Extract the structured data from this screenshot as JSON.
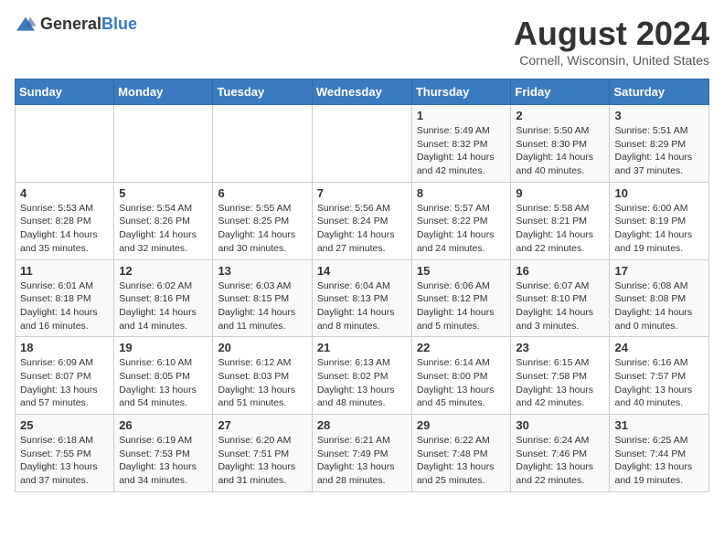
{
  "header": {
    "logo_general": "General",
    "logo_blue": "Blue",
    "month_year": "August 2024",
    "location": "Cornell, Wisconsin, United States"
  },
  "days_of_week": [
    "Sunday",
    "Monday",
    "Tuesday",
    "Wednesday",
    "Thursday",
    "Friday",
    "Saturday"
  ],
  "weeks": [
    [
      {
        "day": "",
        "content": ""
      },
      {
        "day": "",
        "content": ""
      },
      {
        "day": "",
        "content": ""
      },
      {
        "day": "",
        "content": ""
      },
      {
        "day": "1",
        "content": "Sunrise: 5:49 AM\nSunset: 8:32 PM\nDaylight: 14 hours\nand 42 minutes."
      },
      {
        "day": "2",
        "content": "Sunrise: 5:50 AM\nSunset: 8:30 PM\nDaylight: 14 hours\nand 40 minutes."
      },
      {
        "day": "3",
        "content": "Sunrise: 5:51 AM\nSunset: 8:29 PM\nDaylight: 14 hours\nand 37 minutes."
      }
    ],
    [
      {
        "day": "4",
        "content": "Sunrise: 5:53 AM\nSunset: 8:28 PM\nDaylight: 14 hours\nand 35 minutes."
      },
      {
        "day": "5",
        "content": "Sunrise: 5:54 AM\nSunset: 8:26 PM\nDaylight: 14 hours\nand 32 minutes."
      },
      {
        "day": "6",
        "content": "Sunrise: 5:55 AM\nSunset: 8:25 PM\nDaylight: 14 hours\nand 30 minutes."
      },
      {
        "day": "7",
        "content": "Sunrise: 5:56 AM\nSunset: 8:24 PM\nDaylight: 14 hours\nand 27 minutes."
      },
      {
        "day": "8",
        "content": "Sunrise: 5:57 AM\nSunset: 8:22 PM\nDaylight: 14 hours\nand 24 minutes."
      },
      {
        "day": "9",
        "content": "Sunrise: 5:58 AM\nSunset: 8:21 PM\nDaylight: 14 hours\nand 22 minutes."
      },
      {
        "day": "10",
        "content": "Sunrise: 6:00 AM\nSunset: 8:19 PM\nDaylight: 14 hours\nand 19 minutes."
      }
    ],
    [
      {
        "day": "11",
        "content": "Sunrise: 6:01 AM\nSunset: 8:18 PM\nDaylight: 14 hours\nand 16 minutes."
      },
      {
        "day": "12",
        "content": "Sunrise: 6:02 AM\nSunset: 8:16 PM\nDaylight: 14 hours\nand 14 minutes."
      },
      {
        "day": "13",
        "content": "Sunrise: 6:03 AM\nSunset: 8:15 PM\nDaylight: 14 hours\nand 11 minutes."
      },
      {
        "day": "14",
        "content": "Sunrise: 6:04 AM\nSunset: 8:13 PM\nDaylight: 14 hours\nand 8 minutes."
      },
      {
        "day": "15",
        "content": "Sunrise: 6:06 AM\nSunset: 8:12 PM\nDaylight: 14 hours\nand 5 minutes."
      },
      {
        "day": "16",
        "content": "Sunrise: 6:07 AM\nSunset: 8:10 PM\nDaylight: 14 hours\nand 3 minutes."
      },
      {
        "day": "17",
        "content": "Sunrise: 6:08 AM\nSunset: 8:08 PM\nDaylight: 14 hours\nand 0 minutes."
      }
    ],
    [
      {
        "day": "18",
        "content": "Sunrise: 6:09 AM\nSunset: 8:07 PM\nDaylight: 13 hours\nand 57 minutes."
      },
      {
        "day": "19",
        "content": "Sunrise: 6:10 AM\nSunset: 8:05 PM\nDaylight: 13 hours\nand 54 minutes."
      },
      {
        "day": "20",
        "content": "Sunrise: 6:12 AM\nSunset: 8:03 PM\nDaylight: 13 hours\nand 51 minutes."
      },
      {
        "day": "21",
        "content": "Sunrise: 6:13 AM\nSunset: 8:02 PM\nDaylight: 13 hours\nand 48 minutes."
      },
      {
        "day": "22",
        "content": "Sunrise: 6:14 AM\nSunset: 8:00 PM\nDaylight: 13 hours\nand 45 minutes."
      },
      {
        "day": "23",
        "content": "Sunrise: 6:15 AM\nSunset: 7:58 PM\nDaylight: 13 hours\nand 42 minutes."
      },
      {
        "day": "24",
        "content": "Sunrise: 6:16 AM\nSunset: 7:57 PM\nDaylight: 13 hours\nand 40 minutes."
      }
    ],
    [
      {
        "day": "25",
        "content": "Sunrise: 6:18 AM\nSunset: 7:55 PM\nDaylight: 13 hours\nand 37 minutes."
      },
      {
        "day": "26",
        "content": "Sunrise: 6:19 AM\nSunset: 7:53 PM\nDaylight: 13 hours\nand 34 minutes."
      },
      {
        "day": "27",
        "content": "Sunrise: 6:20 AM\nSunset: 7:51 PM\nDaylight: 13 hours\nand 31 minutes."
      },
      {
        "day": "28",
        "content": "Sunrise: 6:21 AM\nSunset: 7:49 PM\nDaylight: 13 hours\nand 28 minutes."
      },
      {
        "day": "29",
        "content": "Sunrise: 6:22 AM\nSunset: 7:48 PM\nDaylight: 13 hours\nand 25 minutes."
      },
      {
        "day": "30",
        "content": "Sunrise: 6:24 AM\nSunset: 7:46 PM\nDaylight: 13 hours\nand 22 minutes."
      },
      {
        "day": "31",
        "content": "Sunrise: 6:25 AM\nSunset: 7:44 PM\nDaylight: 13 hours\nand 19 minutes."
      }
    ]
  ]
}
